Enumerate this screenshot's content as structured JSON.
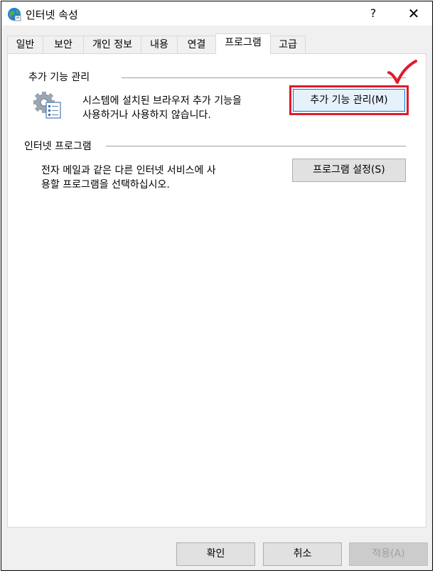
{
  "window": {
    "title": "인터넷 속성",
    "help_label": "?",
    "close_label": "✕"
  },
  "tabs": [
    {
      "label": "일반"
    },
    {
      "label": "보안"
    },
    {
      "label": "개인 정보"
    },
    {
      "label": "내용"
    },
    {
      "label": "연결"
    },
    {
      "label": "프로그램",
      "active": true
    },
    {
      "label": "고급"
    }
  ],
  "addons": {
    "group_label": "추가 기능 관리",
    "description_line1": "시스템에 설치된 브라우저 추가 기능을",
    "description_line2": "사용하거나 사용하지 않습니다.",
    "button_label": "추가 기능 관리(M)",
    "icon": "gear-list-icon"
  },
  "internet_programs": {
    "group_label": "인터넷 프로그램",
    "description_line1": "전자 메일과 같은 다른 인터넷 서비스에 사",
    "description_line2": "용할 프로그램을 선택하십시오.",
    "button_label": "프로그램 설정(S)"
  },
  "footer": {
    "ok_label": "확인",
    "cancel_label": "취소",
    "apply_label": "적용(A)"
  },
  "colors": {
    "highlight": "#e11a2a",
    "focus": "#0078d7"
  }
}
